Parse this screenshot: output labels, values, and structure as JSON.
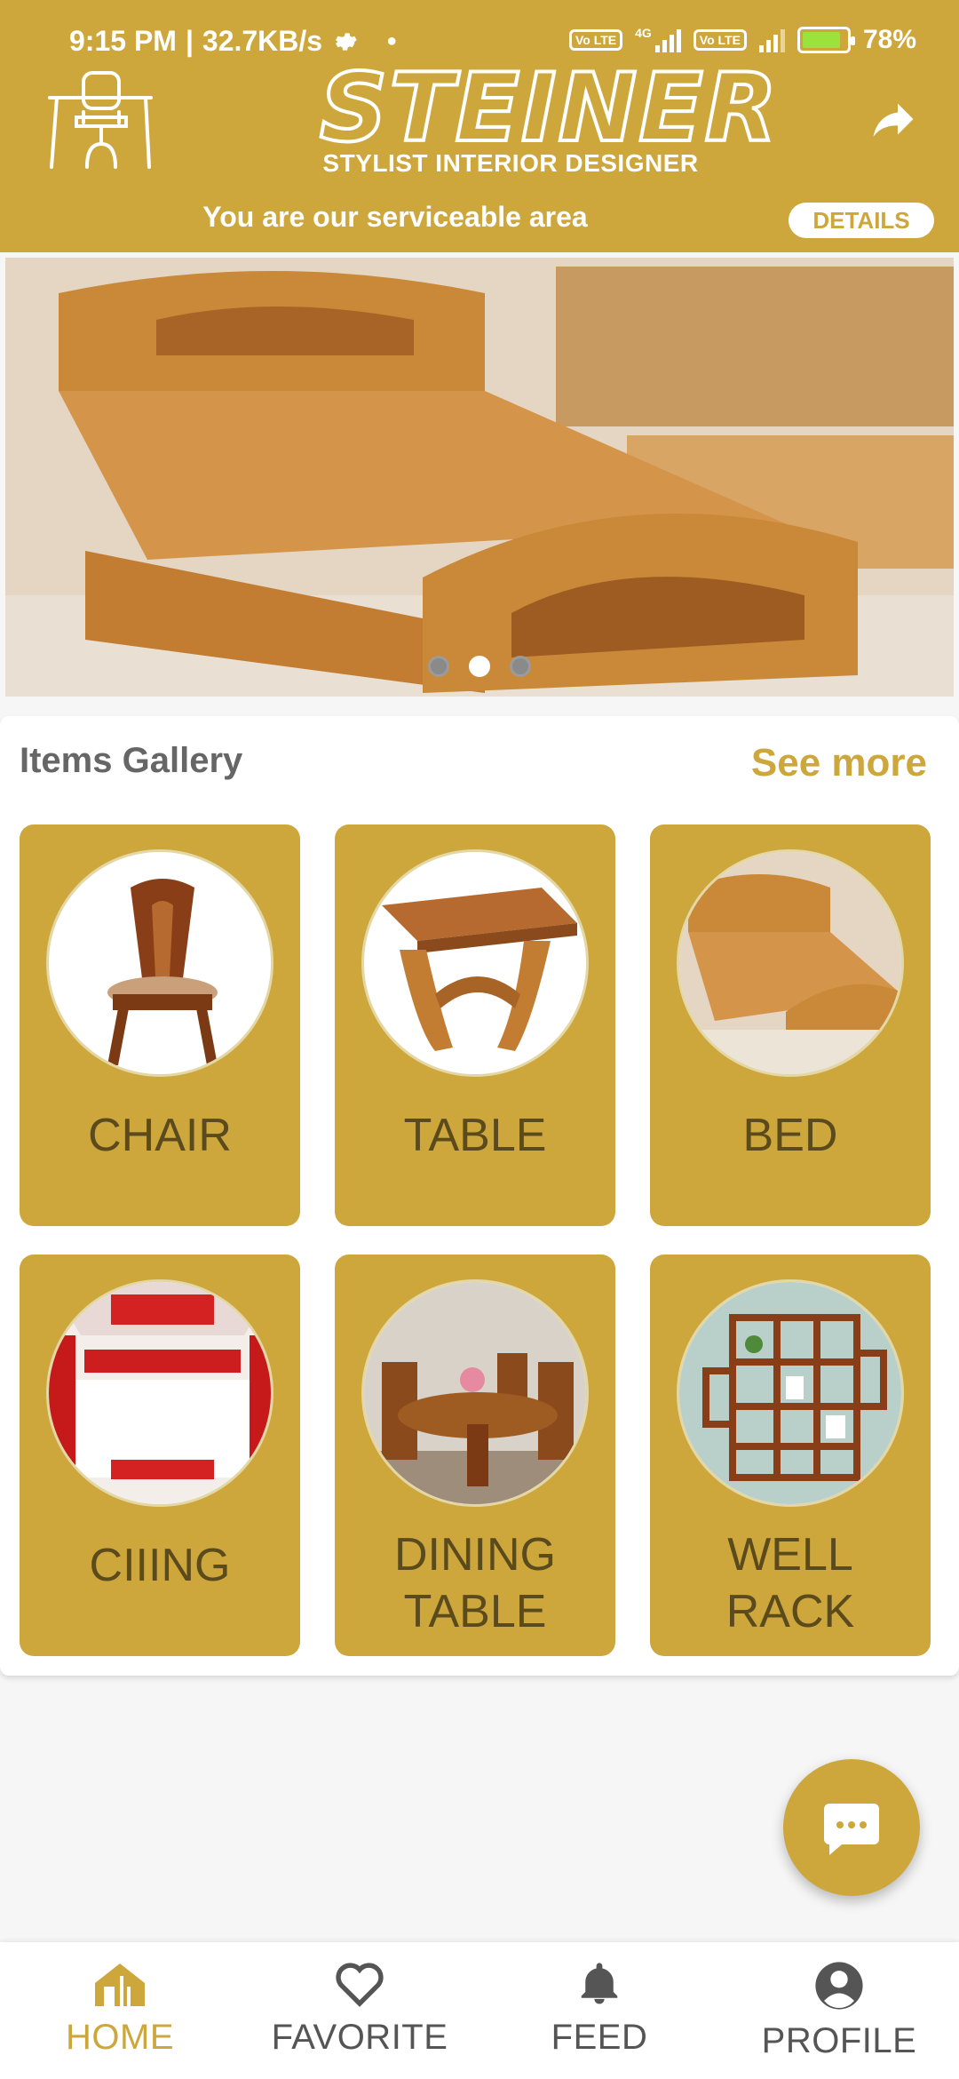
{
  "status_bar": {
    "time": "9:15 PM",
    "net_speed": "32.7KB/s",
    "network_1": "4G",
    "volte_label": "Vo LTE",
    "battery": "78%"
  },
  "header": {
    "brand_name": "STEINER",
    "tagline": "STYLIST INTERIOR DESIGNER",
    "service_text": "You are our serviceable area",
    "details_label": "DETAILS"
  },
  "banner": {
    "slide_count": 3,
    "active_slide": 2
  },
  "gallery": {
    "title": "Items Gallery",
    "see_more": "See more",
    "items": [
      {
        "label": "CHAIR"
      },
      {
        "label": "TABLE"
      },
      {
        "label": "BED"
      },
      {
        "label": "CIIING"
      },
      {
        "label_line1": "DINING",
        "label_line2": "TABLE"
      },
      {
        "label_line1": "WELL",
        "label_line2": "RACK"
      }
    ]
  },
  "bottom_nav": {
    "items": [
      {
        "label": "HOME",
        "icon": "home-icon",
        "active": true
      },
      {
        "label": "FAVORITE",
        "icon": "heart-icon",
        "active": false
      },
      {
        "label": "FEED",
        "icon": "bell-icon",
        "active": false
      },
      {
        "label": "PROFILE",
        "icon": "account-icon",
        "active": false
      }
    ]
  },
  "colors": {
    "brand": "#cda73c",
    "tile_text": "#5a4a1c",
    "background": "#f6f6f6"
  }
}
